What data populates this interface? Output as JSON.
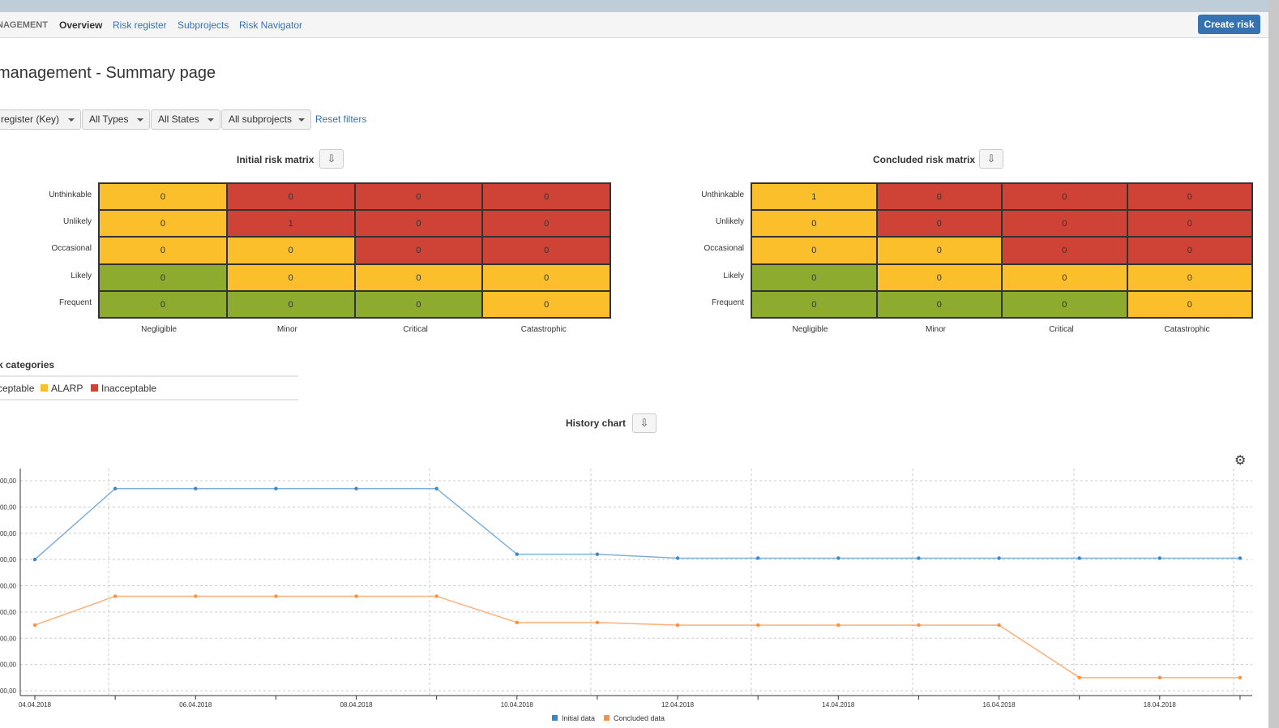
{
  "nav": {
    "brand": "NAGEMENT",
    "items": [
      "Overview",
      "Risk register",
      "Subprojects",
      "Risk Navigator"
    ],
    "create": "Create risk"
  },
  "page_title": "management - Summary page",
  "filters": [
    "register (Key)",
    "All Types",
    "All States",
    "All subprojects"
  ],
  "reset": "Reset filters",
  "colors": {
    "acceptable": "#8cab2f",
    "alarp": "#fbbf2b",
    "inacceptable": "#cf4337",
    "initial": "#3b86c6",
    "concluded": "#ff8f3d"
  },
  "matrices": [
    {
      "title": "Initial risk matrix",
      "rows": [
        "Unthinkable",
        "Unlikely",
        "Occasional",
        "Likely",
        "Frequent"
      ],
      "cols": [
        "Negligible",
        "Minor",
        "Critical",
        "Catastrophic"
      ],
      "values": [
        [
          0,
          0,
          0,
          0
        ],
        [
          0,
          1,
          0,
          0
        ],
        [
          0,
          0,
          0,
          0
        ],
        [
          0,
          0,
          0,
          0
        ],
        [
          0,
          0,
          0,
          0
        ]
      ],
      "categories": [
        [
          "alarp",
          "inacceptable",
          "inacceptable",
          "inacceptable"
        ],
        [
          "alarp",
          "inacceptable",
          "inacceptable",
          "inacceptable"
        ],
        [
          "alarp",
          "alarp",
          "inacceptable",
          "inacceptable"
        ],
        [
          "acceptable",
          "alarp",
          "alarp",
          "alarp"
        ],
        [
          "acceptable",
          "acceptable",
          "acceptable",
          "alarp"
        ]
      ]
    },
    {
      "title": "Concluded risk matrix",
      "rows": [
        "Unthinkable",
        "Unlikely",
        "Occasional",
        "Likely",
        "Frequent"
      ],
      "cols": [
        "Negligible",
        "Minor",
        "Critical",
        "Catastrophic"
      ],
      "values": [
        [
          1,
          0,
          0,
          0
        ],
        [
          0,
          0,
          0,
          0
        ],
        [
          0,
          0,
          0,
          0
        ],
        [
          0,
          0,
          0,
          0
        ],
        [
          0,
          0,
          0,
          0
        ]
      ],
      "categories": [
        [
          "alarp",
          "inacceptable",
          "inacceptable",
          "inacceptable"
        ],
        [
          "alarp",
          "inacceptable",
          "inacceptable",
          "inacceptable"
        ],
        [
          "alarp",
          "alarp",
          "inacceptable",
          "inacceptable"
        ],
        [
          "acceptable",
          "alarp",
          "alarp",
          "alarp"
        ],
        [
          "acceptable",
          "acceptable",
          "acceptable",
          "alarp"
        ]
      ]
    }
  ],
  "risk_categories": {
    "title": "k categories",
    "items": [
      {
        "label": "ceptable",
        "key": "acceptable"
      },
      {
        "label": "ALARP",
        "key": "alarp"
      },
      {
        "label": "Inacceptable",
        "key": "inacceptable"
      }
    ]
  },
  "history": {
    "title": "History chart"
  },
  "chart_data": {
    "type": "line",
    "x": [
      "04.04.2018",
      "05.04.2018",
      "06.04.2018",
      "07.04.2018",
      "08.04.2018",
      "09.04.2018",
      "10.04.2018",
      "11.04.2018",
      "12.04.2018",
      "13.04.2018",
      "14.04.2018",
      "15.04.2018",
      "16.04.2018",
      "17.04.2018",
      "18.04.2018",
      "19.04.2018"
    ],
    "x_tick_labels": [
      "04.04.2018",
      "06.04.2018",
      "08.04.2018",
      "10.04.2018",
      "12.04.2018",
      "14.04.2018",
      "16.04.2018",
      "18.04.2018"
    ],
    "y_tick_labels": [
      "00,00",
      "00,00",
      "00,00",
      "00,00",
      "00,00",
      "00,00",
      "00,00",
      "00,00",
      "00,00"
    ],
    "ylim": [
      0,
      8
    ],
    "grid": true,
    "legend": "bottom",
    "series": [
      {
        "name": "Initial data",
        "values": [
          5.0,
          7.7,
          7.7,
          7.7,
          7.7,
          7.7,
          5.2,
          5.2,
          5.05,
          5.05,
          5.05,
          5.05,
          5.05,
          5.05,
          5.05,
          5.05
        ]
      },
      {
        "name": "Concluded data",
        "values": [
          2.5,
          3.6,
          3.6,
          3.6,
          3.6,
          3.6,
          2.6,
          2.6,
          2.5,
          2.5,
          2.5,
          2.5,
          2.5,
          0.5,
          0.5,
          0.5
        ]
      }
    ]
  }
}
